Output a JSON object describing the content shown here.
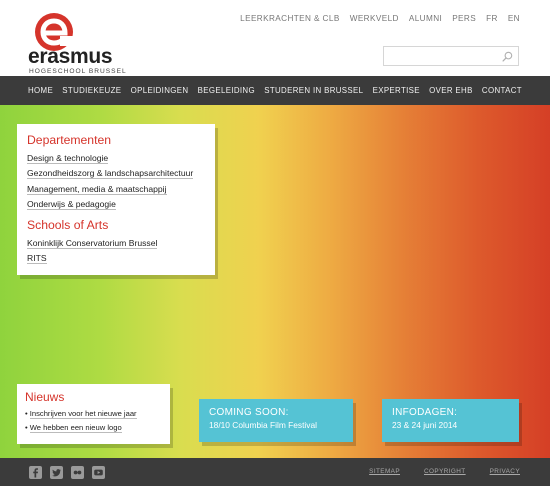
{
  "brand": {
    "name": "erasmus",
    "subtitle": "HOGESCHOOL BRUSSEL",
    "color": "#d5342b"
  },
  "toplinks": [
    "LEERKRACHTEN & CLB",
    "WERKVELD",
    "ALUMNI",
    "PERS",
    "FR",
    "EN"
  ],
  "search": {
    "placeholder": "",
    "icon": "search-icon"
  },
  "nav": [
    "HOME",
    "STUDIEKEUZE",
    "OPLEIDINGEN",
    "BEGELEIDING",
    "STUDEREN IN BRUSSEL",
    "EXPERTISE",
    "OVER EHB",
    "CONTACT"
  ],
  "departments": {
    "heading": "Departementen",
    "items": [
      "Design & technologie",
      "Gezondheidszorg & landschapsarchitectuur",
      "Management, media & maatschappij",
      "Onderwijs & pedagogie"
    ]
  },
  "schools": {
    "heading": "Schools of Arts",
    "items": [
      "Koninklijk Conservatorium Brussel",
      "RITS"
    ]
  },
  "news": {
    "heading": "Nieuws",
    "items": [
      "Inschrijven voor het nieuwe jaar",
      "We hebben een nieuw logo"
    ]
  },
  "promos": [
    {
      "title": "COMING SOON:",
      "subtitle": "18/10 Columbia Film Festival"
    },
    {
      "title": "INFODAGEN:",
      "subtitle": "23 & 24 juni 2014"
    }
  ],
  "footer": {
    "social": [
      "facebook-icon",
      "twitter-icon",
      "flickr-icon",
      "youtube-icon"
    ],
    "links": [
      "SITEMAP",
      "COPYRIGHT",
      "PRIVACY"
    ]
  },
  "colors": {
    "accent": "#d5342b",
    "nav_bg": "#3b3b3b",
    "promo": "#55c3d4"
  }
}
